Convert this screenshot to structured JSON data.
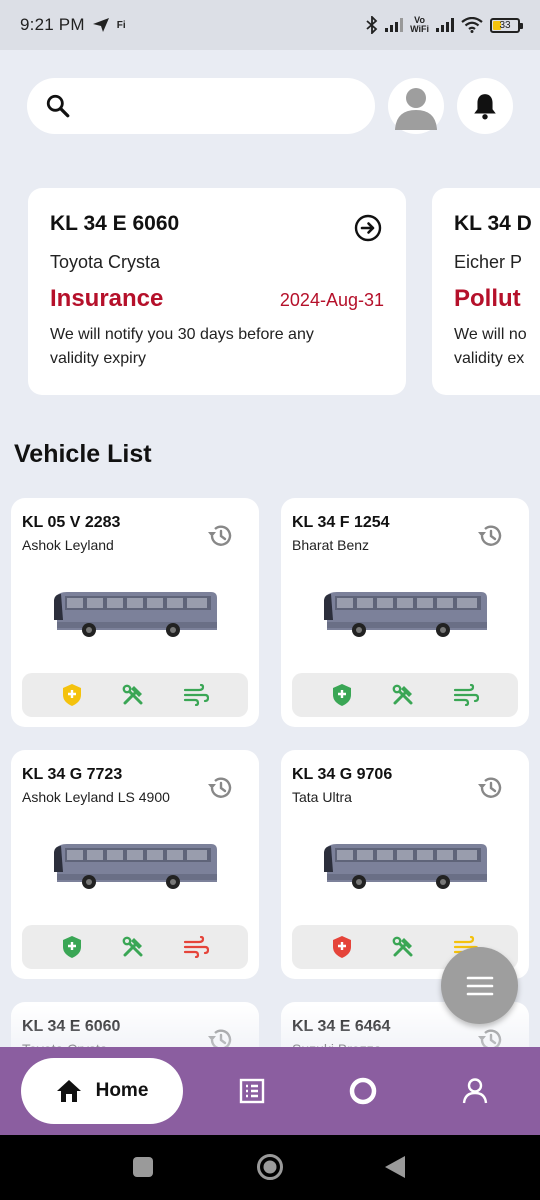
{
  "status_bar": {
    "time": "9:21 PM",
    "carrier_tag": "Fi",
    "vowifi_top": "Vo",
    "vowifi_bottom": "WiFi",
    "battery": "33"
  },
  "search": {
    "placeholder": ""
  },
  "reminders": [
    {
      "plate": "KL 34 E 6060",
      "model": "Toyota Crysta",
      "doc_type": "Insurance",
      "expiry": "2024-Aug-31",
      "note": "We will notify you 30 days before any validity expiry"
    },
    {
      "plate": "KL 34 D",
      "model": "Eicher P",
      "doc_type": "Pollut",
      "note": "We will no validity ex"
    }
  ],
  "section_title": "Vehicle List",
  "vehicles": [
    {
      "plate": "KL 05 V 2283",
      "brand": "Ashok Leyland",
      "insurance": "#f4c20d",
      "service": "#3aa655",
      "pollution": "#3aa655"
    },
    {
      "plate": "KL 34 F 1254",
      "brand": "Bharat Benz",
      "insurance": "#3aa655",
      "service": "#3aa655",
      "pollution": "#3aa655"
    },
    {
      "plate": "KL 34 G 7723",
      "brand": "Ashok Leyland LS 4900",
      "insurance": "#3aa655",
      "service": "#3aa655",
      "pollution": "#e5443a"
    },
    {
      "plate": "KL 34 G 9706",
      "brand": "Tata Ultra",
      "insurance": "#e5443a",
      "service": "#3aa655",
      "pollution": "#f4c20d"
    },
    {
      "plate": "KL 34 E 6060",
      "brand": "Toyota Crysta"
    },
    {
      "plate": "KL 34 E 6464",
      "brand": "Suzuki Brezza"
    }
  ],
  "bottom_nav": {
    "home_label": "Home"
  },
  "colors": {
    "accent": "#8b5ea0",
    "alert": "#b5102a",
    "ok": "#3aa655",
    "warn": "#f4c20d",
    "bad": "#e5443a"
  }
}
